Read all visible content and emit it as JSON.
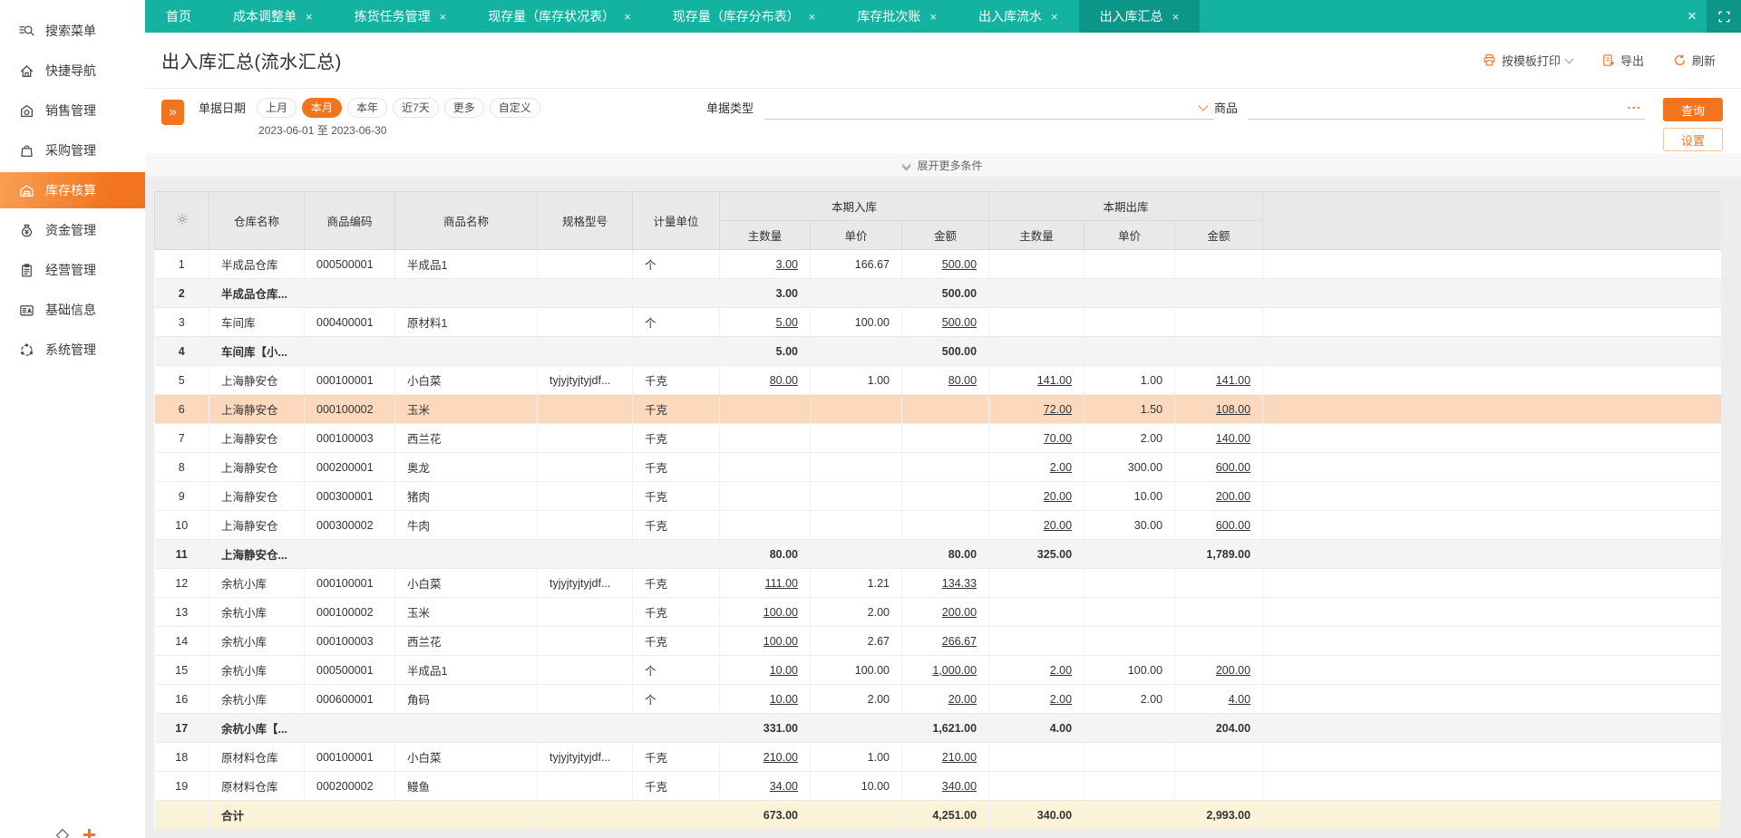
{
  "window": {
    "close": "×"
  },
  "sidebar": {
    "items": [
      {
        "label": "搜索菜单",
        "icon": "search-icon",
        "active": false
      },
      {
        "label": "快捷导航",
        "icon": "nav-home-icon",
        "active": false
      },
      {
        "label": "销售管理",
        "icon": "sales-icon",
        "active": false
      },
      {
        "label": "采购管理",
        "icon": "purchase-bag-icon",
        "active": false
      },
      {
        "label": "库存核算",
        "icon": "inventory-warehouse-icon",
        "active": true
      },
      {
        "label": "资金管理",
        "icon": "funds-pouch-icon",
        "active": false
      },
      {
        "label": "经营管理",
        "icon": "business-clipboard-icon",
        "active": false
      },
      {
        "label": "基础信息",
        "icon": "basic-info-card-icon",
        "active": false
      },
      {
        "label": "系统管理",
        "icon": "system-circle-icon",
        "active": false
      }
    ]
  },
  "tabs": [
    {
      "label": "首页",
      "closable": false,
      "active": false
    },
    {
      "label": "成本调整单",
      "closable": true,
      "active": false
    },
    {
      "label": "拣货任务管理",
      "closable": true,
      "active": false
    },
    {
      "label": "现存量（库存状况表）",
      "closable": true,
      "active": false
    },
    {
      "label": "现存量（库存分布表）",
      "closable": true,
      "active": false
    },
    {
      "label": "库存批次账",
      "closable": true,
      "active": false
    },
    {
      "label": "出入库流水",
      "closable": true,
      "active": false
    },
    {
      "label": "出入库汇总",
      "closable": true,
      "active": true
    }
  ],
  "header": {
    "title": "出入库汇总(流水汇总)",
    "print_label": "按模板打印",
    "export_label": "导出",
    "refresh_label": "刷新"
  },
  "filters": {
    "doc_date_label": "单据日期",
    "quick_ranges": [
      "上月",
      "本月",
      "本年",
      "近7天",
      "更多",
      "自定义"
    ],
    "selected_range": "本月",
    "date_range": "2023-06-01 至 2023-06-30",
    "doc_type_label": "单据类型",
    "product_label": "商品",
    "product_ellipsis": "...",
    "query_button": "查询",
    "settings_button": "设置",
    "expand_more_label": "展开更多条件"
  },
  "table": {
    "columns": [
      "仓库名称",
      "商品编码",
      "商品名称",
      "规格型号",
      "计量单位"
    ],
    "group_in": "本期入库",
    "group_out": "本期出库",
    "sub_columns": [
      "主数量",
      "单价",
      "金额"
    ],
    "rows": [
      {
        "no": "1",
        "wh": "半成品仓库",
        "code": "000500001",
        "name": "半成品1",
        "spec": "",
        "unit": "个",
        "iq": "3.00",
        "ip": "166.67",
        "ia": "500.00",
        "oq": "",
        "op": "",
        "oa": "",
        "type": "normal"
      },
      {
        "no": "2",
        "wh": "半成品仓库...",
        "code": "",
        "name": "",
        "spec": "",
        "unit": "",
        "iq": "3.00",
        "ip": "",
        "ia": "500.00",
        "oq": "",
        "op": "",
        "oa": "",
        "type": "subtotal"
      },
      {
        "no": "3",
        "wh": "车间库",
        "code": "000400001",
        "name": "原材料1",
        "spec": "",
        "unit": "个",
        "iq": "5.00",
        "ip": "100.00",
        "ia": "500.00",
        "oq": "",
        "op": "",
        "oa": "",
        "type": "normal"
      },
      {
        "no": "4",
        "wh": "车间库【小...",
        "code": "",
        "name": "",
        "spec": "",
        "unit": "",
        "iq": "5.00",
        "ip": "",
        "ia": "500.00",
        "oq": "",
        "op": "",
        "oa": "",
        "type": "subtotal"
      },
      {
        "no": "5",
        "wh": "上海静安仓",
        "code": "000100001",
        "name": "小白菜",
        "spec": "tyjyjtyjtyjdf...",
        "unit": "千克",
        "iq": "80.00",
        "ip": "1.00",
        "ia": "80.00",
        "oq": "141.00",
        "op": "1.00",
        "oa": "141.00",
        "type": "normal"
      },
      {
        "no": "6",
        "wh": "上海静安仓",
        "code": "000100002",
        "name": "玉米",
        "spec": "",
        "unit": "千克",
        "iq": "",
        "ip": "",
        "ia": "",
        "oq": "72.00",
        "op": "1.50",
        "oa": "108.00",
        "type": "highlight"
      },
      {
        "no": "7",
        "wh": "上海静安仓",
        "code": "000100003",
        "name": "西兰花",
        "spec": "",
        "unit": "千克",
        "iq": "",
        "ip": "",
        "ia": "",
        "oq": "70.00",
        "op": "2.00",
        "oa": "140.00",
        "type": "normal"
      },
      {
        "no": "8",
        "wh": "上海静安仓",
        "code": "000200001",
        "name": "奥龙",
        "spec": "",
        "unit": "千克",
        "iq": "",
        "ip": "",
        "ia": "",
        "oq": "2.00",
        "op": "300.00",
        "oa": "600.00",
        "type": "normal"
      },
      {
        "no": "9",
        "wh": "上海静安仓",
        "code": "000300001",
        "name": "猪肉",
        "spec": "",
        "unit": "千克",
        "iq": "",
        "ip": "",
        "ia": "",
        "oq": "20.00",
        "op": "10.00",
        "oa": "200.00",
        "type": "normal"
      },
      {
        "no": "10",
        "wh": "上海静安仓",
        "code": "000300002",
        "name": "牛肉",
        "spec": "",
        "unit": "千克",
        "iq": "",
        "ip": "",
        "ia": "",
        "oq": "20.00",
        "op": "30.00",
        "oa": "600.00",
        "type": "normal"
      },
      {
        "no": "11",
        "wh": "上海静安仓...",
        "code": "",
        "name": "",
        "spec": "",
        "unit": "",
        "iq": "80.00",
        "ip": "",
        "ia": "80.00",
        "oq": "325.00",
        "op": "",
        "oa": "1,789.00",
        "type": "subtotal"
      },
      {
        "no": "12",
        "wh": "余杭小库",
        "code": "000100001",
        "name": "小白菜",
        "spec": "tyjyjtyjtyjdf...",
        "unit": "千克",
        "iq": "111.00",
        "ip": "1.21",
        "ia": "134.33",
        "oq": "",
        "op": "",
        "oa": "",
        "type": "normal"
      },
      {
        "no": "13",
        "wh": "余杭小库",
        "code": "000100002",
        "name": "玉米",
        "spec": "",
        "unit": "千克",
        "iq": "100.00",
        "ip": "2.00",
        "ia": "200.00",
        "oq": "",
        "op": "",
        "oa": "",
        "type": "normal"
      },
      {
        "no": "14",
        "wh": "余杭小库",
        "code": "000100003",
        "name": "西兰花",
        "spec": "",
        "unit": "千克",
        "iq": "100.00",
        "ip": "2.67",
        "ia": "266.67",
        "oq": "",
        "op": "",
        "oa": "",
        "type": "normal"
      },
      {
        "no": "15",
        "wh": "余杭小库",
        "code": "000500001",
        "name": "半成品1",
        "spec": "",
        "unit": "个",
        "iq": "10.00",
        "ip": "100.00",
        "ia": "1,000.00",
        "oq": "2.00",
        "op": "100.00",
        "oa": "200.00",
        "type": "normal"
      },
      {
        "no": "16",
        "wh": "余杭小库",
        "code": "000600001",
        "name": "角码",
        "spec": "",
        "unit": "个",
        "iq": "10.00",
        "ip": "2.00",
        "ia": "20.00",
        "oq": "2.00",
        "op": "2.00",
        "oa": "4.00",
        "type": "normal"
      },
      {
        "no": "17",
        "wh": "余杭小库【...",
        "code": "",
        "name": "",
        "spec": "",
        "unit": "",
        "iq": "331.00",
        "ip": "",
        "ia": "1,621.00",
        "oq": "4.00",
        "op": "",
        "oa": "204.00",
        "type": "subtotal"
      },
      {
        "no": "18",
        "wh": "原材料仓库",
        "code": "000100001",
        "name": "小白菜",
        "spec": "tyjyjtyjtyjdf...",
        "unit": "千克",
        "iq": "210.00",
        "ip": "1.00",
        "ia": "210.00",
        "oq": "",
        "op": "",
        "oa": "",
        "type": "normal"
      },
      {
        "no": "19",
        "wh": "原材料仓库",
        "code": "000200002",
        "name": "鳗鱼",
        "spec": "",
        "unit": "千克",
        "iq": "34.00",
        "ip": "10.00",
        "ia": "340.00",
        "oq": "",
        "op": "",
        "oa": "",
        "type": "normal"
      },
      {
        "no": "",
        "wh": "合计",
        "code": "",
        "name": "",
        "spec": "",
        "unit": "",
        "iq": "673.00",
        "ip": "",
        "ia": "4,251.00",
        "oq": "340.00",
        "op": "",
        "oa": "2,993.00",
        "type": "total"
      }
    ]
  },
  "colors": {
    "accent_orange": "#f3741f",
    "teal_bar": "#14b3a1",
    "teal_active_tab": "#0b9688",
    "highlight_row": "#fcd9bd",
    "total_row": "#fbf3d7"
  }
}
